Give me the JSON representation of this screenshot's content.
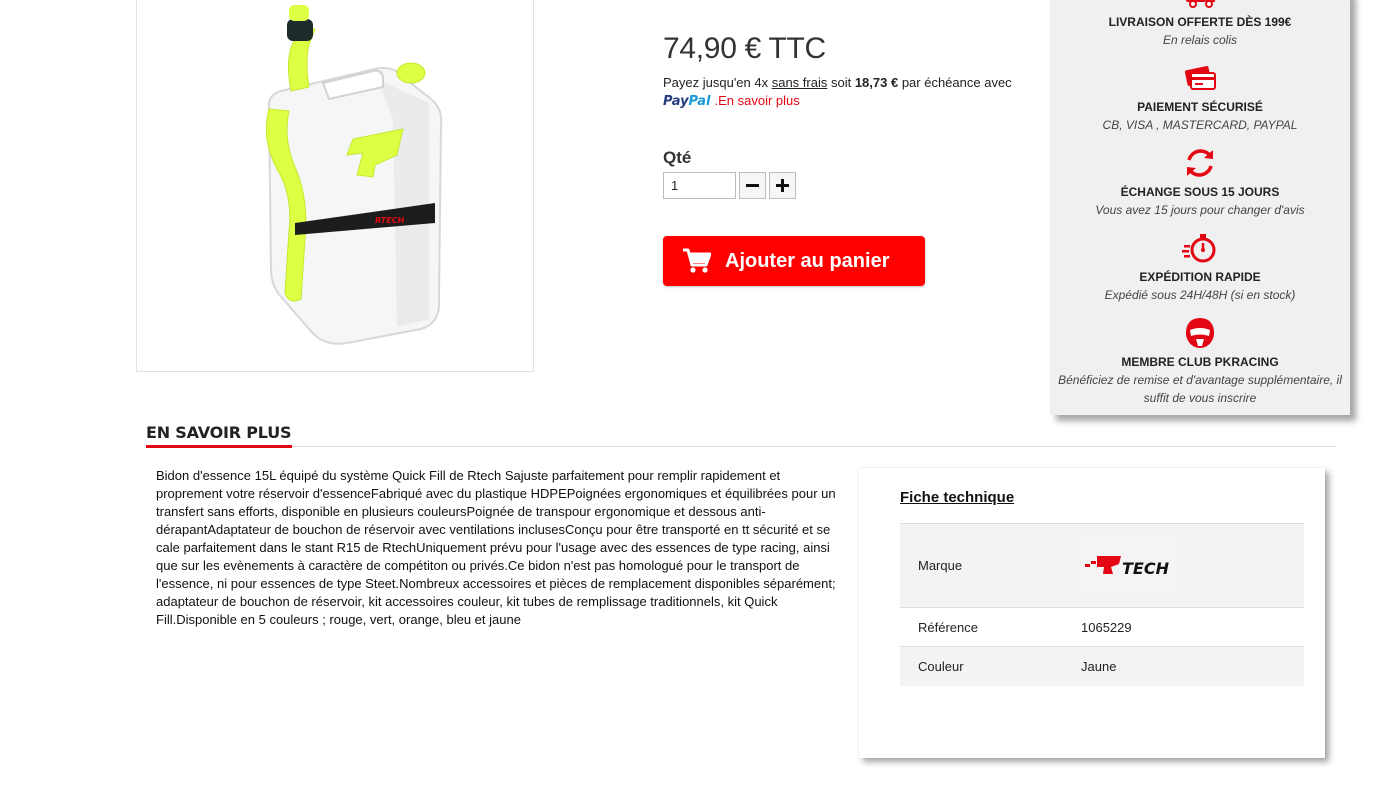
{
  "product": {
    "price": "74,90 € TTC",
    "paypal": {
      "text_before": "Payez jusqu'en 4x ",
      "sans_frais": "sans frais",
      "text_soit": " soit ",
      "amount": "18,73 €",
      "text_after": " par échéance avec",
      "logo_pay": "Pay",
      "logo_pal": "Pal",
      "learn_more": ".En savoir plus"
    },
    "qty_label": "Qté",
    "qty_value": "1",
    "add_to_cart": "Ajouter au panier",
    "image_icon": "jerrycan-image"
  },
  "reassurance": [
    {
      "icon": "truck-icon",
      "title": "LIVRAISON OFFERTE DÈS 199€",
      "subtitle": "En relais colis"
    },
    {
      "icon": "credit-card-icon",
      "title": "PAIEMENT SÉCURISÉ",
      "subtitle": "CB, VISA , MASTERCARD, PAYPAL"
    },
    {
      "icon": "exchange-icon",
      "title": "ÉCHANGE SOUS 15 JOURS",
      "subtitle": "Vous avez 15 jours pour changer d'avis"
    },
    {
      "icon": "stopwatch-icon",
      "title": "EXPÉDITION RAPIDE",
      "subtitle": "Expédié sous 24H/48H (si en stock)"
    },
    {
      "icon": "helmet-icon",
      "title": "MEMBRE CLUB PKRACING",
      "subtitle": "Bénéficiez de remise et d'avantage supplémentaire, il suffit de vous inscrire"
    }
  ],
  "more_info": {
    "title": "EN SAVOIR PLUS",
    "description": "Bidon d'essence 15L équipé du système Quick Fill de Rtech Sajuste parfaitement pour remplir rapidement et proprement votre réservoir d'essenceFabriqué avec du plastique HDPEPoignées ergonomiques et équilibrées pour un transfert sans efforts, disponible en plusieurs couleursPoignée de transpour ergonomique et dessous anti-dérapantAdaptateur de bouchon de réservoir avec ventilations inclusesConçu pour être transporté en tt sécurité et se cale parfaitement dans le stant R15 de RtechUniquement prévu pour l'usage avec des essences de type racing, ainsi que sur les evènements à caractère de compétiton ou privés.Ce bidon n'est pas homologué pour le transport de l'essence, ni pour essences de type Steet.Nombreux accessoires et pièces de remplacement disponibles séparément; adaptateur de bouchon de réservoir, kit accessoires couleur, kit tubes de remplissage traditionnels, kit Quick Fill.Disponible en 5 couleurs ; rouge, vert, orange, bleu et jaune"
  },
  "tech_sheet": {
    "title": "Fiche technique",
    "rows": [
      {
        "key": "Marque",
        "value": "",
        "logo": "rtech-logo",
        "logo_text": "TECH"
      },
      {
        "key": "Référence",
        "value": "1065229"
      },
      {
        "key": "Couleur",
        "value": "Jaune"
      }
    ]
  },
  "colors": {
    "accent": "#e30613",
    "cart_button": "#ff0000",
    "jerrycan_yellow": "#ddff44",
    "sidebar_bg": "#f0f0f0"
  }
}
